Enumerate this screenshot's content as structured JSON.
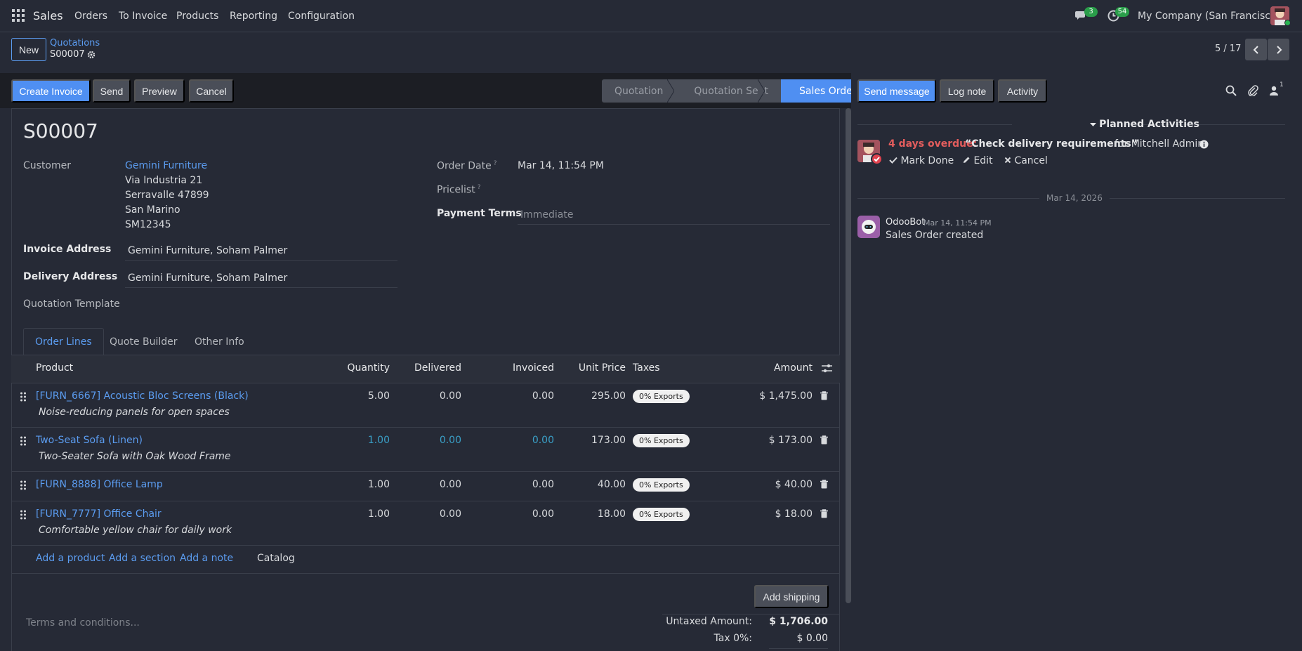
{
  "navbar": {
    "app_name": "Sales",
    "menus": [
      "Orders",
      "To Invoice",
      "Products",
      "Reporting",
      "Configuration"
    ],
    "chat_count": "3",
    "activity_count": "54",
    "company": "My Company (San Francisco)"
  },
  "control": {
    "new_label": "New",
    "breadcrumb_parent": "Quotations",
    "record_name": "S00007",
    "pager": "5 / 17"
  },
  "actions": {
    "create_invoice": "Create Invoice",
    "send": "Send",
    "preview": "Preview",
    "cancel": "Cancel"
  },
  "statusbar": {
    "stages": [
      "Quotation",
      "Quotation Sent",
      "Sales Order"
    ],
    "active": "Sales Order"
  },
  "form": {
    "title": "S00007",
    "customer_label": "Customer",
    "customer_name": "Gemini Furniture",
    "address_lines": [
      "Via Industria 21",
      "Serravalle 47899",
      "San Marino",
      "SM12345"
    ],
    "invoice_address_label": "Invoice Address",
    "invoice_address": "Gemini Furniture, Soham Palmer",
    "delivery_address_label": "Delivery Address",
    "delivery_address": "Gemini Furniture, Soham Palmer",
    "quotation_template_label": "Quotation Template",
    "order_date_label": "Order Date",
    "order_date": "Mar 14, 11:54 PM",
    "pricelist_label": "Pricelist",
    "payment_terms_label": "Payment Terms",
    "payment_terms_placeholder": "Immediate",
    "help_mark": "?"
  },
  "tabs": [
    "Order Lines",
    "Quote Builder",
    "Other Info"
  ],
  "table": {
    "headers": {
      "product": "Product",
      "quantity": "Quantity",
      "delivered": "Delivered",
      "invoiced": "Invoiced",
      "unit_price": "Unit Price",
      "taxes": "Taxes",
      "amount": "Amount"
    },
    "rows": [
      {
        "product": "[FURN_6667] Acoustic Bloc Screens (Black)",
        "description": "Noise-reducing panels for open spaces",
        "quantity": "5.00",
        "delivered": "0.00",
        "invoiced": "0.00",
        "unit_price": "295.00",
        "tax": "0% Exports",
        "amount": "$ 1,475.00"
      },
      {
        "product": "Two-Seat Sofa (Linen)",
        "description": "Two-Seater Sofa with Oak Wood Frame",
        "quantity": "1.00",
        "delivered": "0.00",
        "invoiced": "0.00",
        "unit_price": "173.00",
        "tax": "0% Exports",
        "amount": "$ 173.00"
      },
      {
        "product": "[FURN_8888] Office Lamp",
        "description": "",
        "quantity": "1.00",
        "delivered": "0.00",
        "invoiced": "0.00",
        "unit_price": "40.00",
        "tax": "0% Exports",
        "amount": "$ 40.00"
      },
      {
        "product": "[FURN_7777] Office Chair",
        "description": "Comfortable yellow chair for daily work",
        "quantity": "1.00",
        "delivered": "0.00",
        "invoiced": "0.00",
        "unit_price": "18.00",
        "tax": "0% Exports",
        "amount": "$ 18.00"
      }
    ],
    "add_product": "Add a product",
    "add_section": "Add a section",
    "add_note": "Add a note",
    "catalog": "Catalog"
  },
  "footer": {
    "add_shipping": "Add shipping",
    "terms_placeholder": "Terms and conditions...",
    "untaxed_label": "Untaxed Amount:",
    "untaxed_value": "$ 1,706.00",
    "tax_label": "Tax 0%:",
    "tax_value": "$ 0.00"
  },
  "chatter": {
    "send_message": "Send message",
    "log_note": "Log note",
    "activity": "Activity",
    "followers_count": "1",
    "planned_activities": "Planned Activities",
    "overdue": "4 days overdue:",
    "summary": "“Check delivery requirements”",
    "for_user": "for Mitchell Admin",
    "mark_done": "Mark Done",
    "edit": "Edit",
    "cancel": "Cancel",
    "date_separator": "Mar 14, 2026",
    "message_author": "OdooBot",
    "message_date": "Mar 14, 11:54 PM",
    "message_body": "Sales Order created"
  },
  "colors": {
    "background": "#262a36",
    "primary": "#4f8ff2",
    "link": "#5b9cf0",
    "badge_green": "#2a9d4a",
    "overdue_red": "#e35d5d"
  }
}
